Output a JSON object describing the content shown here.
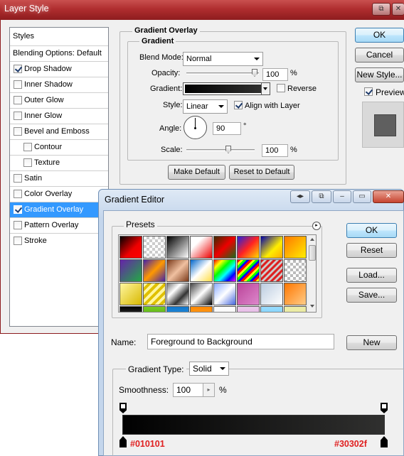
{
  "layer_style": {
    "title": "Layer Style",
    "styles_header": "Styles",
    "blending_options": "Blending Options: Default",
    "items": [
      {
        "label": "Drop Shadow",
        "checked": true
      },
      {
        "label": "Inner Shadow",
        "checked": false
      },
      {
        "label": "Outer Glow",
        "checked": false
      },
      {
        "label": "Inner Glow",
        "checked": false
      },
      {
        "label": "Bevel and Emboss",
        "checked": false
      },
      {
        "label": "Contour",
        "checked": false
      },
      {
        "label": "Texture",
        "checked": false
      },
      {
        "label": "Satin",
        "checked": false
      },
      {
        "label": "Color Overlay",
        "checked": false
      },
      {
        "label": "Gradient Overlay",
        "checked": true
      },
      {
        "label": "Pattern Overlay",
        "checked": false
      },
      {
        "label": "Stroke",
        "checked": false
      }
    ],
    "group_title": "Gradient Overlay",
    "sub_title": "Gradient",
    "blend_mode_label": "Blend Mode:",
    "blend_mode": "Normal",
    "opacity_label": "Opacity:",
    "opacity": "100",
    "percent": "%",
    "gradient_label": "Gradient:",
    "reverse_label": "Reverse",
    "style_label": "Style:",
    "style_value": "Linear",
    "align_label": "Align with Layer",
    "angle_label": "Angle:",
    "angle_value": "90",
    "degree": "°",
    "scale_label": "Scale:",
    "scale": "100",
    "make_default": "Make Default",
    "reset_default": "Reset to Default",
    "ok": "OK",
    "cancel": "Cancel",
    "new_style": "New Style...",
    "preview": "Preview"
  },
  "gradient_editor": {
    "title": "Gradient Editor",
    "presets_label": "Presets",
    "ok": "OK",
    "reset": "Reset",
    "load": "Load...",
    "save": "Save...",
    "name_label": "Name:",
    "name_value": "Foreground to Background",
    "new": "New",
    "gradient_type_label": "Gradient Type:",
    "gradient_type": "Solid",
    "smoothness_label": "Smoothness:",
    "smoothness": "100",
    "percent": "%",
    "left_stop_color": "#010101",
    "right_stop_color": "#30302f",
    "left_stop_label": "#010101",
    "right_stop_label": "#30302f"
  },
  "colors": {
    "accent_red": "#e02020",
    "selection_blue": "#3399ff"
  }
}
